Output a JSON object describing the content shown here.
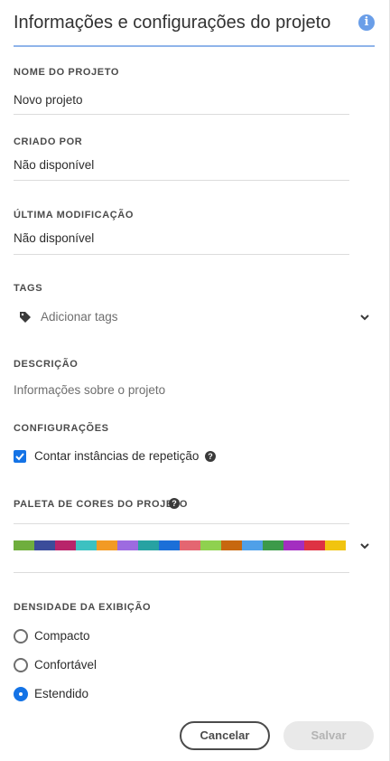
{
  "header": {
    "title": "Informações e configurações do projeto",
    "info_icon": "info-icon"
  },
  "project_name": {
    "label": "NOME DO PROJETO",
    "value": "Novo projeto"
  },
  "created_by": {
    "label": "CRIADO POR",
    "value": "Não disponível"
  },
  "last_modified": {
    "label": "ÚLTIMA MODIFICAÇÃO",
    "value": "Não disponível"
  },
  "tags": {
    "label": "TAGS",
    "placeholder": "Adicionar tags",
    "icon": "tag-icon"
  },
  "description": {
    "label": "DESCRIÇÃO",
    "placeholder": "Informações sobre o projeto"
  },
  "settings": {
    "label": "CONFIGURAÇÕES",
    "checkbox_label": "Contar instâncias de repetição",
    "checked": true
  },
  "palette": {
    "label": "PALETA DE CORES DO PROJETO",
    "colors": [
      "#6fae3d",
      "#3b4c9a",
      "#b8246a",
      "#3cc1c1",
      "#f29a24",
      "#9d6be0",
      "#27a2a2",
      "#1b6fd8",
      "#e46671",
      "#8fd14f",
      "#c7680f",
      "#4fa0e8",
      "#3c9a4a",
      "#a32ec0",
      "#de3243",
      "#f1c40f"
    ]
  },
  "density": {
    "label": "DENSIDADE DA EXIBIÇÃO",
    "options": [
      "Compacto",
      "Confortável",
      "Estendido"
    ],
    "selected": "Estendido"
  },
  "buttons": {
    "cancel": "Cancelar",
    "save": "Salvar"
  }
}
